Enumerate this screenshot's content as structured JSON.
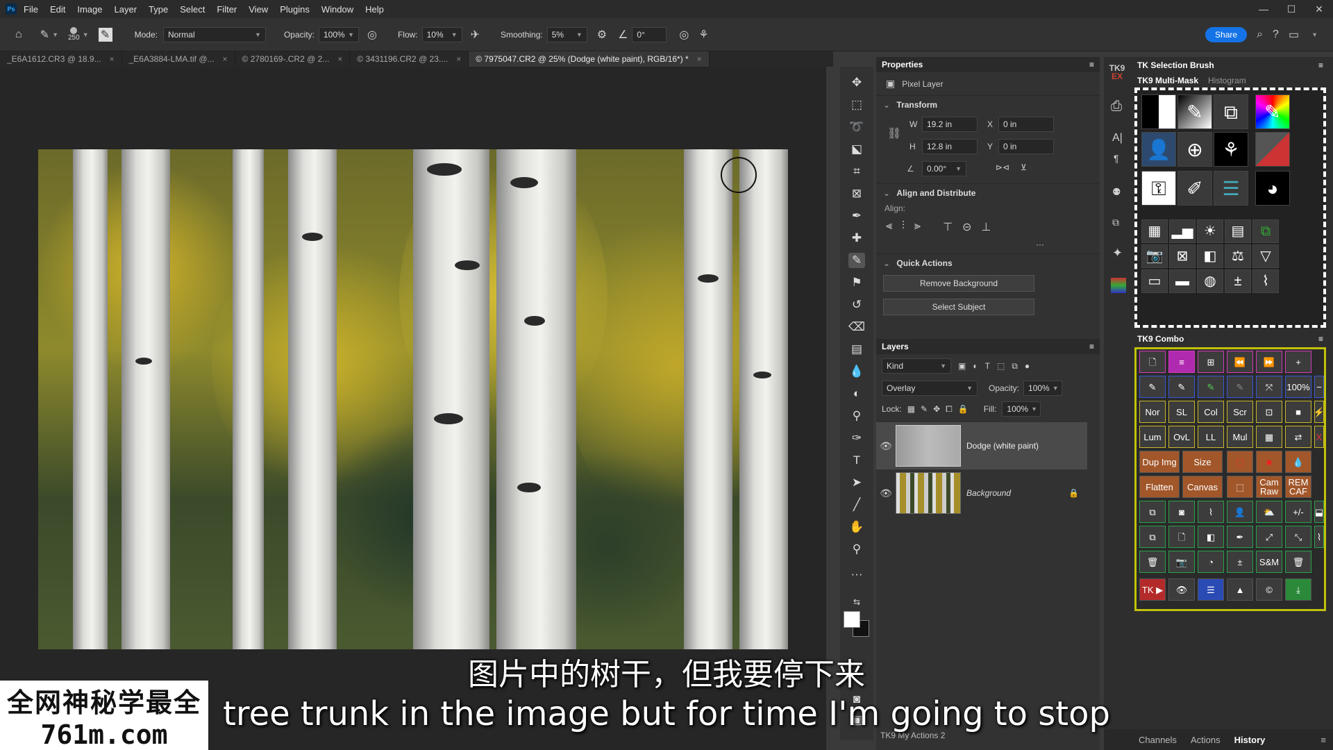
{
  "menubar": {
    "items": [
      "File",
      "Edit",
      "Image",
      "Layer",
      "Type",
      "Select",
      "Filter",
      "View",
      "Plugins",
      "Window",
      "Help"
    ]
  },
  "options": {
    "brush_size": "250",
    "mode_label": "Mode:",
    "mode_value": "Normal",
    "opacity_label": "Opacity:",
    "opacity_value": "100%",
    "flow_label": "Flow:",
    "flow_value": "10%",
    "smoothing_label": "Smoothing:",
    "smoothing_value": "5%",
    "angle_value": "0°",
    "share_label": "Share"
  },
  "tabs": [
    {
      "label": "_E6A1612.CR3 @ 18.9..."
    },
    {
      "label": "_E6A3884-LMA.tif @..."
    },
    {
      "label": "© 2780169-.CR2 @ 2..."
    },
    {
      "label": "© 3431196.CR2 @ 23...."
    },
    {
      "label": "© 7975047.CR2 @ 25% (Dodge (white paint), RGB/16*) *"
    }
  ],
  "properties": {
    "title": "Properties",
    "layer_type": "Pixel Layer",
    "transform_label": "Transform",
    "w_label": "W",
    "w_value": "19.2 in",
    "x_label": "X",
    "x_value": "0 in",
    "h_label": "H",
    "h_value": "12.8 in",
    "y_label": "Y",
    "y_value": "0 in",
    "angle_value": "0.00°",
    "align_section": "Align and Distribute",
    "align_label": "Align:",
    "quick_actions": "Quick Actions",
    "remove_bg": "Remove Background",
    "select_subject": "Select Subject"
  },
  "layers": {
    "title": "Layers",
    "kind_label": "Kind",
    "blend_mode": "Overlay",
    "opacity_label": "Opacity:",
    "opacity_value": "100%",
    "lock_label": "Lock:",
    "fill_label": "Fill:",
    "fill_value": "100%",
    "items": [
      {
        "name": "Dodge (white paint)"
      },
      {
        "name": "Background"
      }
    ]
  },
  "tk": {
    "selection_brush": "TK Selection Brush",
    "multimask_tab": "TK9 Multi-Mask",
    "histogram_tab": "Histogram",
    "combo_title": "TK9 Combo",
    "logo": "TK9",
    "combo_labels": {
      "zoom": "100%",
      "nor": "Nor",
      "sl": "SL",
      "col": "Col",
      "scr": "Scr",
      "lum": "Lum",
      "ovl": "OvL",
      "ll": "LL",
      "mul": "Mul",
      "dup": "Dup Img",
      "size": "Size",
      "flatten": "Flatten",
      "canvas": "Canvas",
      "cam_raw": "Cam Raw",
      "rem_caf": "REM CAF",
      "pm": "+/-",
      "sm": "S&M",
      "tk": "TK ▶"
    },
    "bottom_tabs": [
      "Channels",
      "Actions",
      "History"
    ],
    "my_actions": "TK9 My Actions 2"
  },
  "subtitles": {
    "cn": "图片中的树干，但我要停下来",
    "en": "tree trunk in the image but for time I'm going to stop"
  },
  "watermark": {
    "line1": "全网神秘学最全",
    "line2": "761m.com"
  },
  "colors": {
    "accent": "#1473e6",
    "combo_border": "#c2c20a",
    "orange_button": "#a2572a"
  }
}
